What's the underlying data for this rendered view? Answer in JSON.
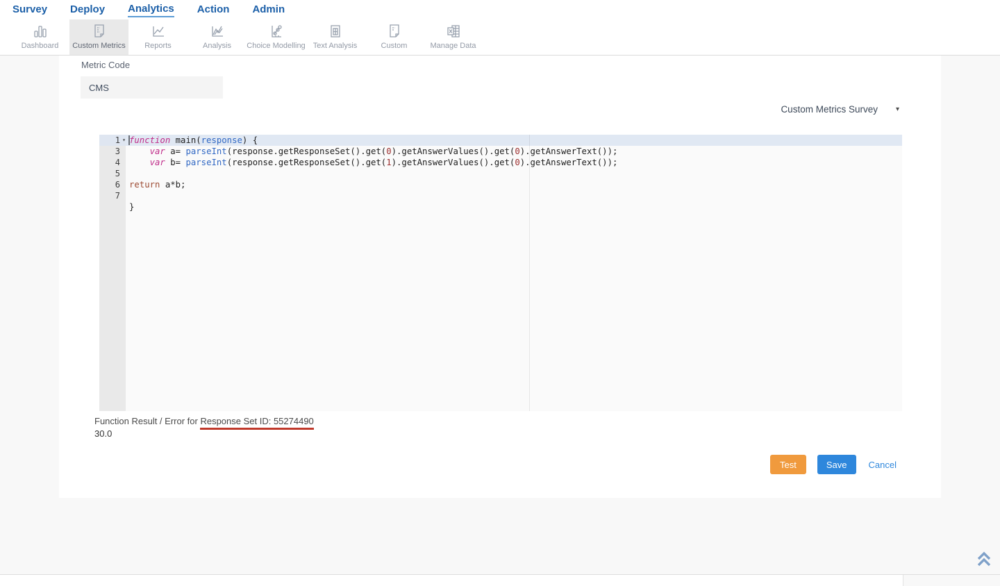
{
  "nav": {
    "items": [
      {
        "label": "Survey",
        "active": false
      },
      {
        "label": "Deploy",
        "active": false
      },
      {
        "label": "Analytics",
        "active": true
      },
      {
        "label": "Action",
        "active": false
      },
      {
        "label": "Admin",
        "active": false
      }
    ]
  },
  "toolbar": {
    "items": [
      {
        "label": "Dashboard",
        "icon": "bar-chart-icon",
        "active": false
      },
      {
        "label": "Custom Metrics",
        "icon": "metrics-document-icon",
        "active": true
      },
      {
        "label": "Reports",
        "icon": "line-chart-icon",
        "active": false
      },
      {
        "label": "Analysis",
        "icon": "trend-chart-icon",
        "active": false
      },
      {
        "label": "Choice Modelling",
        "icon": "scatter-chart-icon",
        "active": false
      },
      {
        "label": "Text Analysis",
        "icon": "text-document-icon",
        "active": false
      },
      {
        "label": "Custom",
        "icon": "custom-document-icon",
        "active": false
      },
      {
        "label": "Manage Data",
        "icon": "excel-spreadsheet-icon",
        "active": false
      }
    ]
  },
  "form": {
    "metric_code_label": "Metric Code",
    "metric_code_value": "CMS",
    "survey_selector_value": "Custom Metrics Survey"
  },
  "editor": {
    "rows": [
      {
        "num": "1",
        "fold": true,
        "active": true,
        "tokens": [
          [
            "kw",
            "function"
          ],
          [
            "pl",
            " main("
          ],
          [
            "fn",
            "response"
          ],
          [
            "pl",
            ") {"
          ]
        ]
      },
      {
        "num": "3",
        "tokens": [
          [
            "pl",
            "    "
          ],
          [
            "kw",
            "var"
          ],
          [
            "pl",
            " a= "
          ],
          [
            "fn",
            "parseInt"
          ],
          [
            "pl",
            "(response.getResponseSet().get("
          ],
          [
            "num",
            "0"
          ],
          [
            "pl",
            ").getAnswerValues().get("
          ],
          [
            "num",
            "0"
          ],
          [
            "pl",
            ").getAnswerText());"
          ]
        ]
      },
      {
        "num": "4",
        "tokens": [
          [
            "pl",
            "    "
          ],
          [
            "kw",
            "var"
          ],
          [
            "pl",
            " b= "
          ],
          [
            "fn",
            "parseInt"
          ],
          [
            "pl",
            "(response.getResponseSet().get("
          ],
          [
            "num",
            "1"
          ],
          [
            "pl",
            ").getAnswerValues().get("
          ],
          [
            "num",
            "0"
          ],
          [
            "pl",
            ").getAnswerText());"
          ]
        ]
      },
      {
        "num": "5",
        "tokens": []
      },
      {
        "num": "6",
        "tokens": [
          [
            "ret",
            "return"
          ],
          [
            "pl",
            " a*b;"
          ]
        ]
      },
      {
        "num": "7",
        "tokens": []
      },
      {
        "num": "",
        "tokens": [
          [
            "pl",
            "}"
          ]
        ]
      }
    ]
  },
  "result": {
    "label_prefix": "Function Result / Error for ",
    "label_underlined": "Response Set ID: 55274490",
    "value": "30.0"
  },
  "actions": {
    "test_label": "Test",
    "save_label": "Save",
    "cancel_label": "Cancel"
  },
  "icons": {
    "dropdown_caret": "▾",
    "fold_caret": "▾"
  },
  "colors": {
    "nav_blue": "#1b5fa8",
    "nav_underline": "#5b9bd5",
    "test_button": "#f09a3d",
    "save_button": "#2e87dc",
    "link_blue": "#2e87dc",
    "error_underline": "#c0392b",
    "scroll_icon": "#7fa1c9",
    "keyword_magenta": "#c02d8a",
    "function_blue": "#3168c4",
    "number_red": "#9d2f2f",
    "return_brown": "#9c4a32"
  }
}
